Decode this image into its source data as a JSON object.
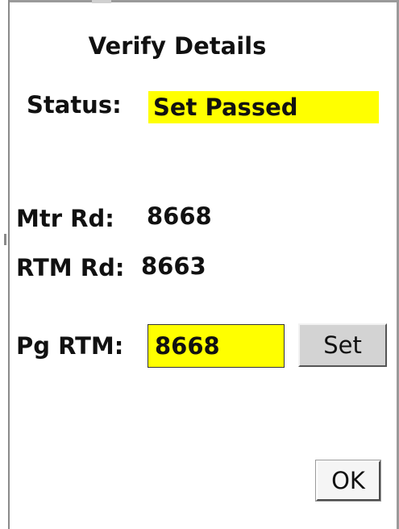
{
  "dialog": {
    "title": "Verify Details"
  },
  "status": {
    "label": "Status:",
    "value": "Set Passed",
    "highlight_color": "#ffff00"
  },
  "readings": {
    "mtr_label": "Mtr Rd:",
    "mtr_value": "8668",
    "rtm_label": "RTM Rd:",
    "rtm_value": "8663"
  },
  "pg_rtm": {
    "label": "Pg RTM:",
    "value": "8668",
    "field_color": "#ffff00",
    "set_label": "Set"
  },
  "footer": {
    "ok_label": "OK"
  }
}
